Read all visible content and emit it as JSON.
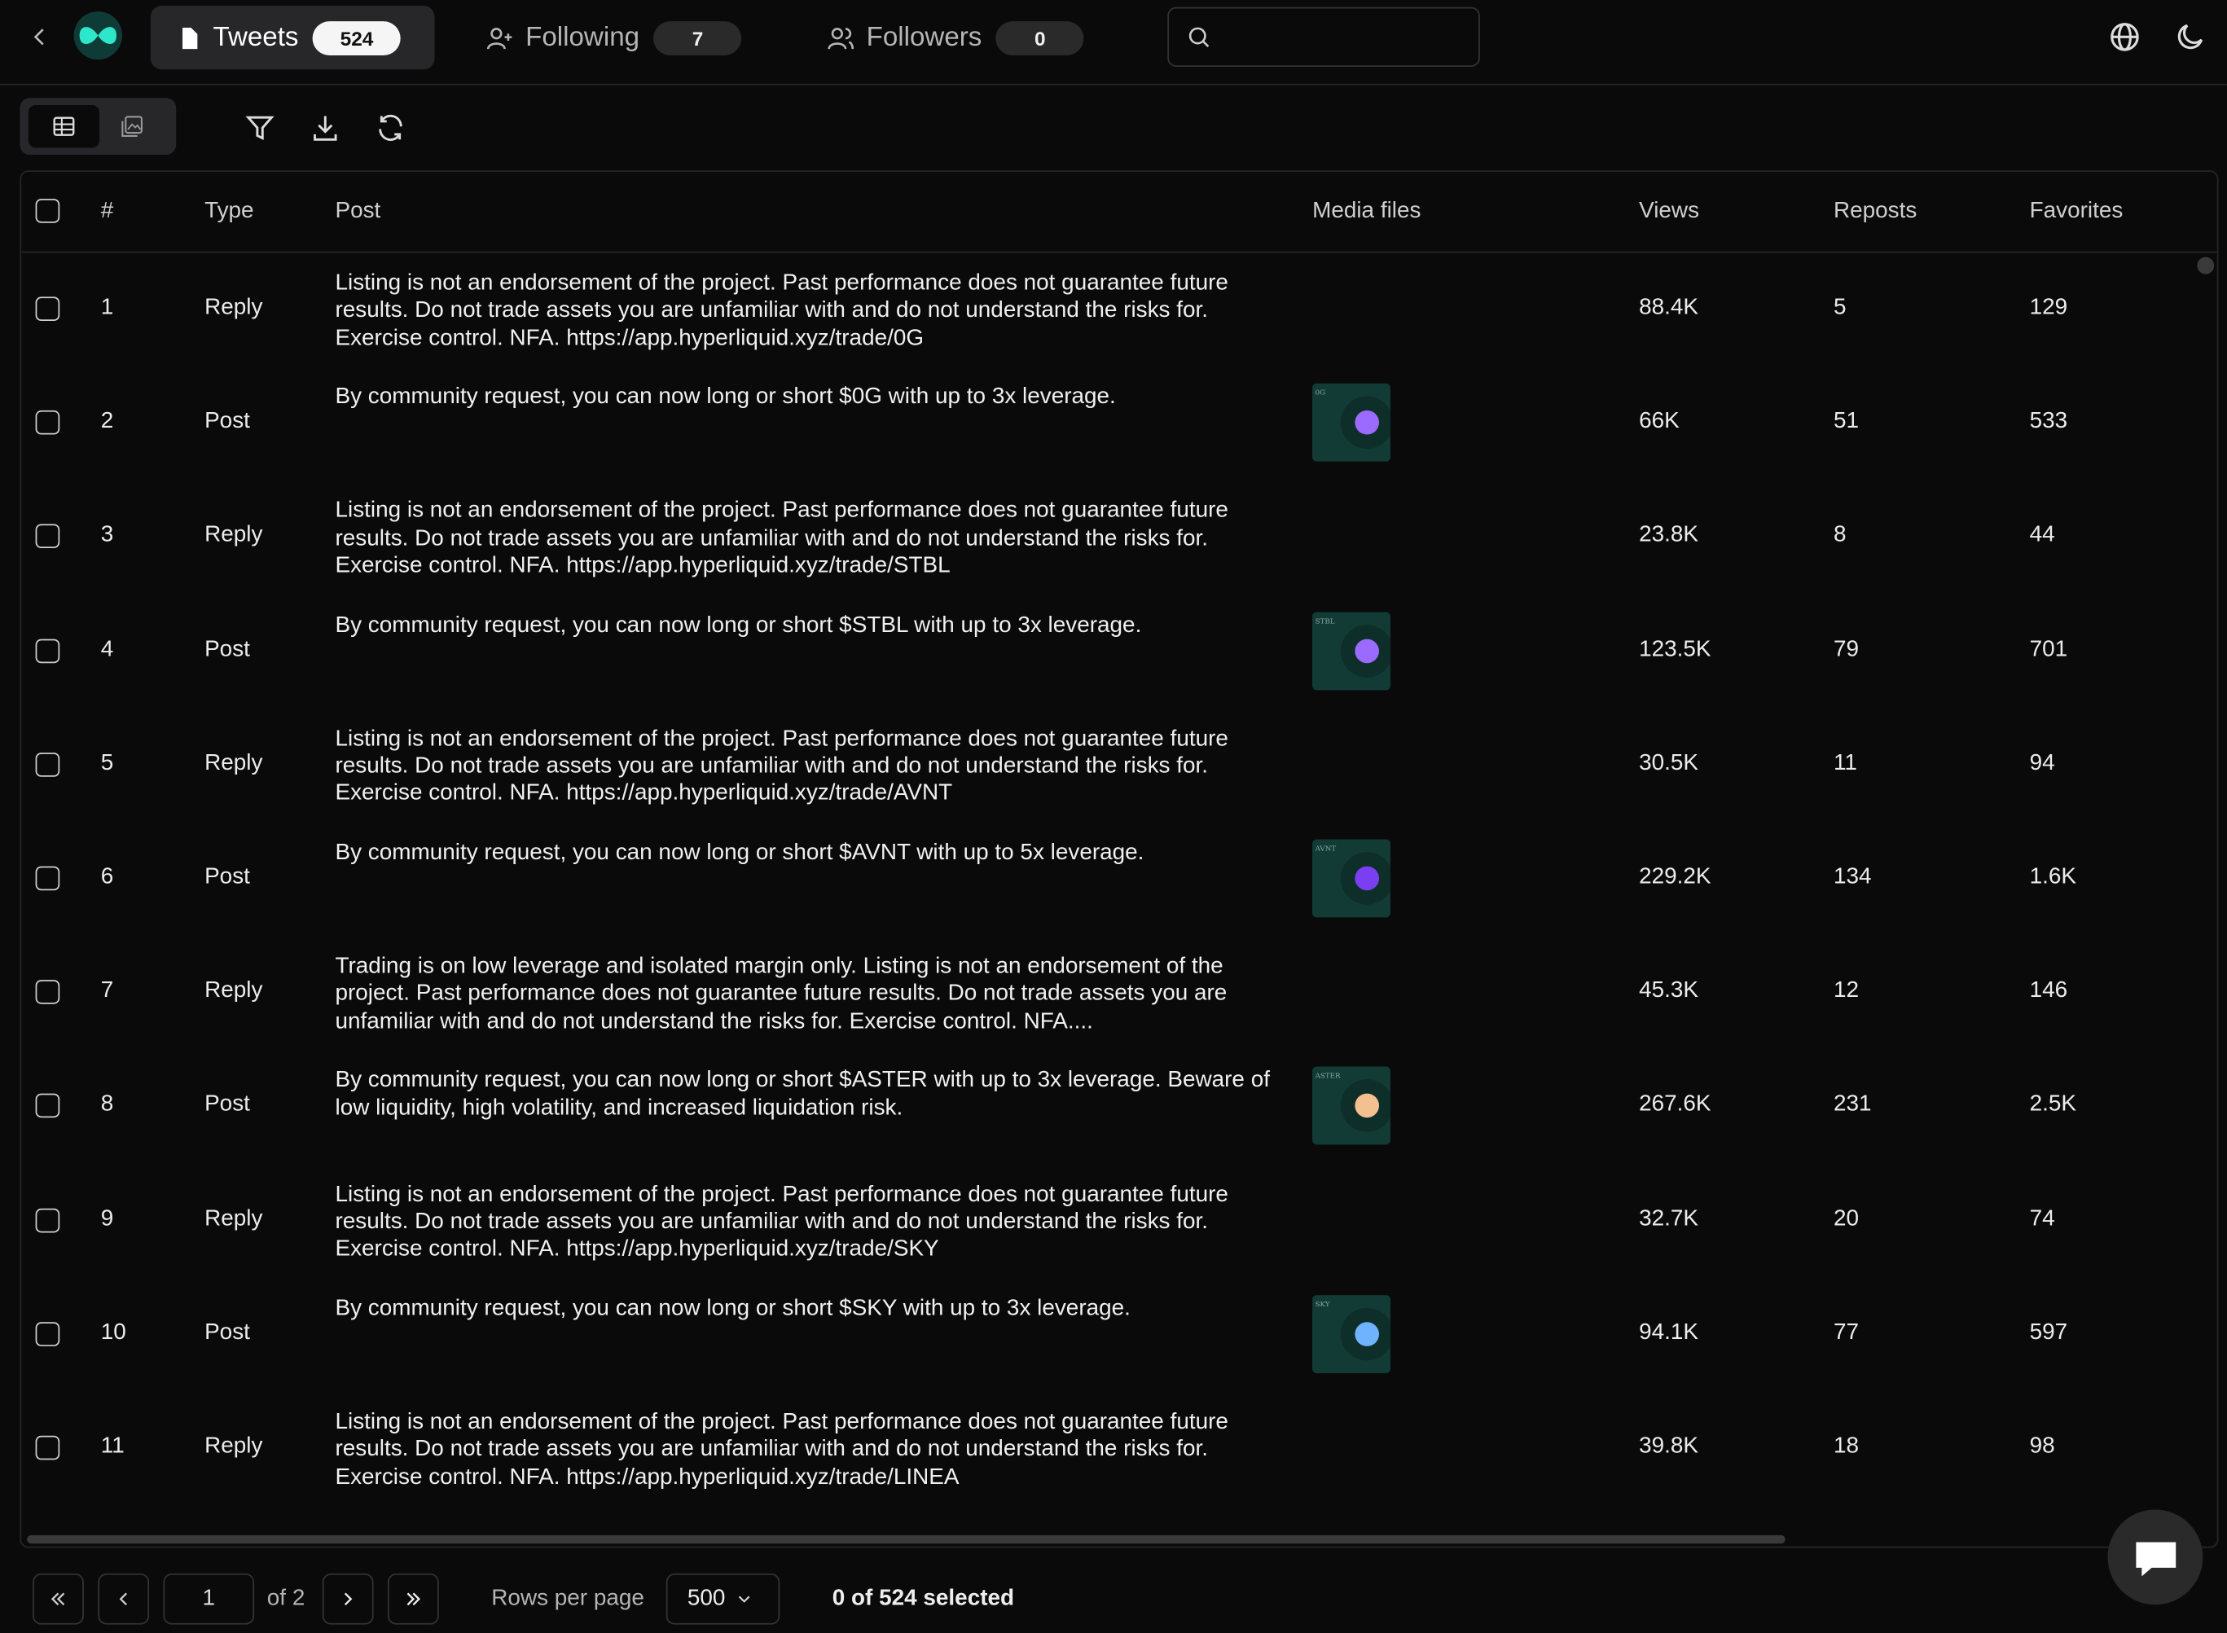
{
  "tabs": [
    {
      "label": "Tweets",
      "count": "524"
    },
    {
      "label": "Following",
      "count": "7"
    },
    {
      "label": "Followers",
      "count": "0"
    }
  ],
  "search": {
    "placeholder": "",
    "value": ""
  },
  "table": {
    "columns": {
      "num": "#",
      "type": "Type",
      "post": "Post",
      "media": "Media files",
      "views": "Views",
      "reposts": "Reposts",
      "favorites": "Favorites"
    },
    "rows": [
      {
        "num": "1",
        "type": "Reply",
        "post": "Listing is not an endorsement of the project. Past performance does not guarantee future results. Do not trade assets you are unfamiliar with and do not understand the risks for. Exercise control. NFA. https://app.hyperliquid.xyz/trade/0G",
        "media": "",
        "views": "88.4K",
        "reposts": "5",
        "favorites": "129"
      },
      {
        "num": "2",
        "type": "Post",
        "post": "By community request, you can now long or short $0G with up to 3x leverage.",
        "media": "0G",
        "views": "66K",
        "reposts": "51",
        "favorites": "533"
      },
      {
        "num": "3",
        "type": "Reply",
        "post": "Listing is not an endorsement of the project. Past performance does not guarantee future results. Do not trade assets you are unfamiliar with and do not understand the risks for. Exercise control. NFA. https://app.hyperliquid.xyz/trade/STBL",
        "media": "",
        "views": "23.8K",
        "reposts": "8",
        "favorites": "44"
      },
      {
        "num": "4",
        "type": "Post",
        "post": "By community request, you can now long or short $STBL with up to 3x leverage.",
        "media": "STBL",
        "views": "123.5K",
        "reposts": "79",
        "favorites": "701"
      },
      {
        "num": "5",
        "type": "Reply",
        "post": "Listing is not an endorsement of the project. Past performance does not guarantee future results. Do not trade assets you are unfamiliar with and do not understand the risks for. Exercise control. NFA. https://app.hyperliquid.xyz/trade/AVNT",
        "media": "",
        "views": "30.5K",
        "reposts": "11",
        "favorites": "94"
      },
      {
        "num": "6",
        "type": "Post",
        "post": "By community request, you can now long or short $AVNT with up to 5x leverage.",
        "media": "AVNT",
        "views": "229.2K",
        "reposts": "134",
        "favorites": "1.6K"
      },
      {
        "num": "7",
        "type": "Reply",
        "post": "Trading is on low leverage and isolated margin only. Listing is not an endorsement of the project. Past performance does not guarantee future results. Do not trade assets you are unfamiliar with and do not understand the risks for. Exercise control. NFA....",
        "media": "",
        "views": "45.3K",
        "reposts": "12",
        "favorites": "146"
      },
      {
        "num": "8",
        "type": "Post",
        "post": "By community request, you can now long or short $ASTER with up to 3x leverage. Beware of low liquidity, high volatility, and increased liquidation risk.",
        "media": "ASTER",
        "views": "267.6K",
        "reposts": "231",
        "favorites": "2.5K"
      },
      {
        "num": "9",
        "type": "Reply",
        "post": "Listing is not an endorsement of the project. Past performance does not guarantee future results. Do not trade assets you are unfamiliar with and do not understand the risks for. Exercise control. NFA. https://app.hyperliquid.xyz/trade/SKY",
        "media": "",
        "views": "32.7K",
        "reposts": "20",
        "favorites": "74"
      },
      {
        "num": "10",
        "type": "Post",
        "post": "By community request, you can now long or short $SKY with up to 3x leverage.",
        "media": "SKY",
        "views": "94.1K",
        "reposts": "77",
        "favorites": "597"
      },
      {
        "num": "11",
        "type": "Reply",
        "post": "Listing is not an endorsement of the project. Past performance does not guarantee future results. Do not trade assets you are unfamiliar with and do not understand the risks for. Exercise control. NFA. https://app.hyperliquid.xyz/trade/LINEA",
        "media": "",
        "views": "39.8K",
        "reposts": "18",
        "favorites": "98"
      }
    ]
  },
  "pagination": {
    "page": "1",
    "of_label": "of 2",
    "rows_per_page_label": "Rows per page",
    "rows_per_page_value": "500",
    "selected_label": "0 of 524 selected"
  },
  "colors": {
    "background": "#0a0a0a",
    "accent": "#2ee6c9",
    "thumb": "#123b35"
  },
  "icons": [
    "back-icon",
    "logo-icon",
    "document-icon",
    "user-plus-icon",
    "users-icon",
    "search-icon",
    "globe-icon",
    "moon-icon",
    "table-view-icon",
    "gallery-view-icon",
    "filter-icon",
    "download-icon",
    "refresh-icon",
    "chat-icon"
  ]
}
